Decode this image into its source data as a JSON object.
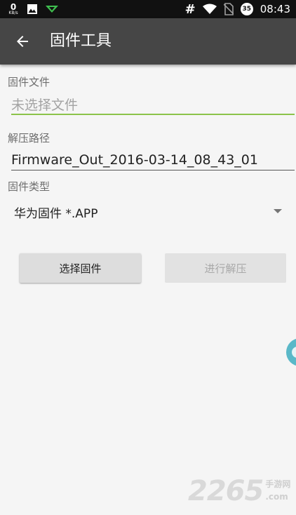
{
  "status_bar": {
    "net_speed_value": "0",
    "net_speed_unit": "KB/s",
    "hash_symbol": "#",
    "badge_number": "35",
    "time": "08:43",
    "icons": [
      "image-icon",
      "download-arrow-icon",
      "wifi-icon",
      "no-sim-icon"
    ]
  },
  "app_bar": {
    "title": "固件工具",
    "back_icon": "arrow-left-icon"
  },
  "form": {
    "firmware_file_label": "固件文件",
    "firmware_file_placeholder": "未选择文件",
    "extract_path_label": "解压路径",
    "extract_path_value": "Firmware_Out_2016-03-14_08_43_01",
    "firmware_type_label": "固件类型",
    "firmware_type_selected": "华为固件 *.APP"
  },
  "buttons": {
    "select_firmware": "选择固件",
    "start_extract": "进行解压"
  },
  "colors": {
    "accent": "#8bc34a",
    "app_bar": "#464646",
    "status_bar": "#111111",
    "background": "#f5f5f5",
    "float_handle": "#5ab8c8"
  },
  "watermark": {
    "number": "2265",
    "site_cn": "手游网",
    "site_tld": ".com"
  }
}
